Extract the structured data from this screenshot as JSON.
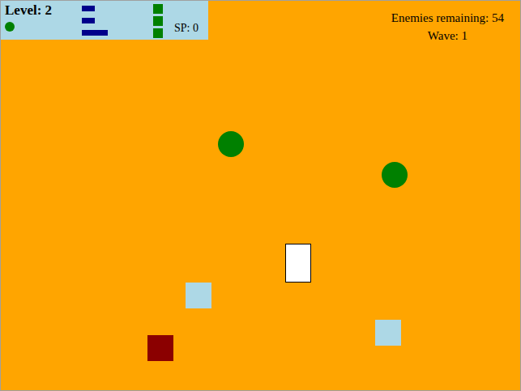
{
  "hud": {
    "level": "Level: 2",
    "life_dots": [
      {
        "color": "#008000"
      }
    ],
    "stat_bars": [
      {
        "level": 0.5
      },
      {
        "level": 0.5
      },
      {
        "level": 1
      }
    ],
    "upgrade_buttons": [
      {
        "color": "#008000"
      },
      {
        "color": "#008000"
      },
      {
        "color": "#008000"
      }
    ],
    "sp": "SP: 0"
  },
  "status": {
    "enemies_remaining": "Enemies remaining: 54",
    "wave": "Wave: 1"
  },
  "entities": [
    {
      "kind": "circle",
      "color": "#008000"
    },
    {
      "kind": "circle",
      "color": "#008000"
    },
    {
      "kind": "player",
      "color": "#ffffff"
    },
    {
      "kind": "square",
      "color": "#add8e6"
    },
    {
      "kind": "square",
      "color": "#add8e6"
    },
    {
      "kind": "square",
      "color": "#8b0000"
    }
  ]
}
